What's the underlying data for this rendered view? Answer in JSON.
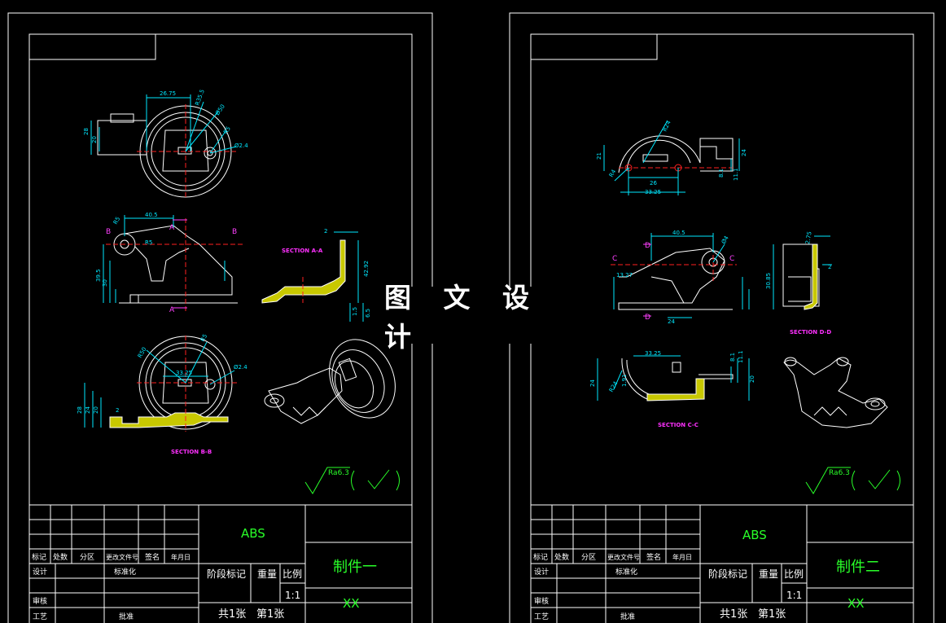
{
  "colors": {
    "frame": "#ffffff",
    "dim": "#00e8ff",
    "center": "#ff2020",
    "section": "#ff30ff",
    "hatch": "#e8e800",
    "title": "#29ff29",
    "arrowlabel": "#ff40ff"
  },
  "watermark": "图 文 设 计",
  "sheets": [
    {
      "material": "ABS",
      "part_name": "制件一",
      "code": "XX",
      "scale": "1:1",
      "sheets_total": "共1张",
      "sheet_no": "第1张",
      "roughness": "Ra6.3",
      "headers": {
        "mark": "标记",
        "count": "处数",
        "zone": "分区",
        "doc": "更改文件号",
        "sign": "签名",
        "date": "年月日",
        "design": "设计",
        "standard": "标准化",
        "review": "审核",
        "process": "工艺",
        "approve": "批准",
        "stage": "阶段标记",
        "weight": "重量",
        "ratio": "比例"
      },
      "labels": {
        "secAA": "SECTION A-A",
        "secBB": "SECTION B-B",
        "A1": "A",
        "A2": "A",
        "B1": "B",
        "B2": "B",
        "d1": "26.75",
        "d2": "R35.5",
        "d3": "Ø50",
        "d4": "R5",
        "d5": "Ø2.4",
        "d6": "28",
        "d7": "20",
        "d8": "40.5",
        "d9": "R5",
        "d10": "R5",
        "d11": "39.5",
        "d12": "30",
        "d13": "2",
        "d14": "42.92",
        "d15": "1.5",
        "d16": "6.5",
        "d17": "33.25",
        "d18": "R50",
        "d19": "Ø2.4",
        "d20": "28",
        "d21": "24",
        "d22": "20",
        "d23": "R5",
        "d24": "2"
      }
    },
    {
      "material": "ABS",
      "part_name": "制件二",
      "code": "XX",
      "scale": "1:1",
      "sheets_total": "共1张",
      "sheet_no": "第1张",
      "roughness": "Ra6.3",
      "headers": {
        "mark": "标记",
        "count": "处数",
        "zone": "分区",
        "doc": "更改文件号",
        "sign": "签名",
        "date": "年月日",
        "design": "设计",
        "standard": "标准化",
        "review": "审核",
        "process": "工艺",
        "approve": "批准",
        "stage": "阶段标记",
        "weight": "重量",
        "ratio": "比例"
      },
      "labels": {
        "secCC": "SECTION C-C",
        "secDD": "SECTION D-D",
        "C1": "C",
        "C2": "C",
        "D1": "D",
        "D2": "D",
        "e1": "R24",
        "e2": "21",
        "e3": "R4",
        "e4": "26",
        "e5": "33.25",
        "e6": "24",
        "e7": "8.1",
        "e8": "11.1",
        "e9": "40.5",
        "e10": "Ø4",
        "e11": "13.27",
        "e12": "24",
        "e13": "2.75",
        "e14": "30.85",
        "e15": "2",
        "e16": "33.25",
        "e17": "R24",
        "e18": "8.1",
        "e19": "11.1",
        "e20": "24",
        "e21": "20",
        "e22": "1.91"
      }
    }
  ]
}
